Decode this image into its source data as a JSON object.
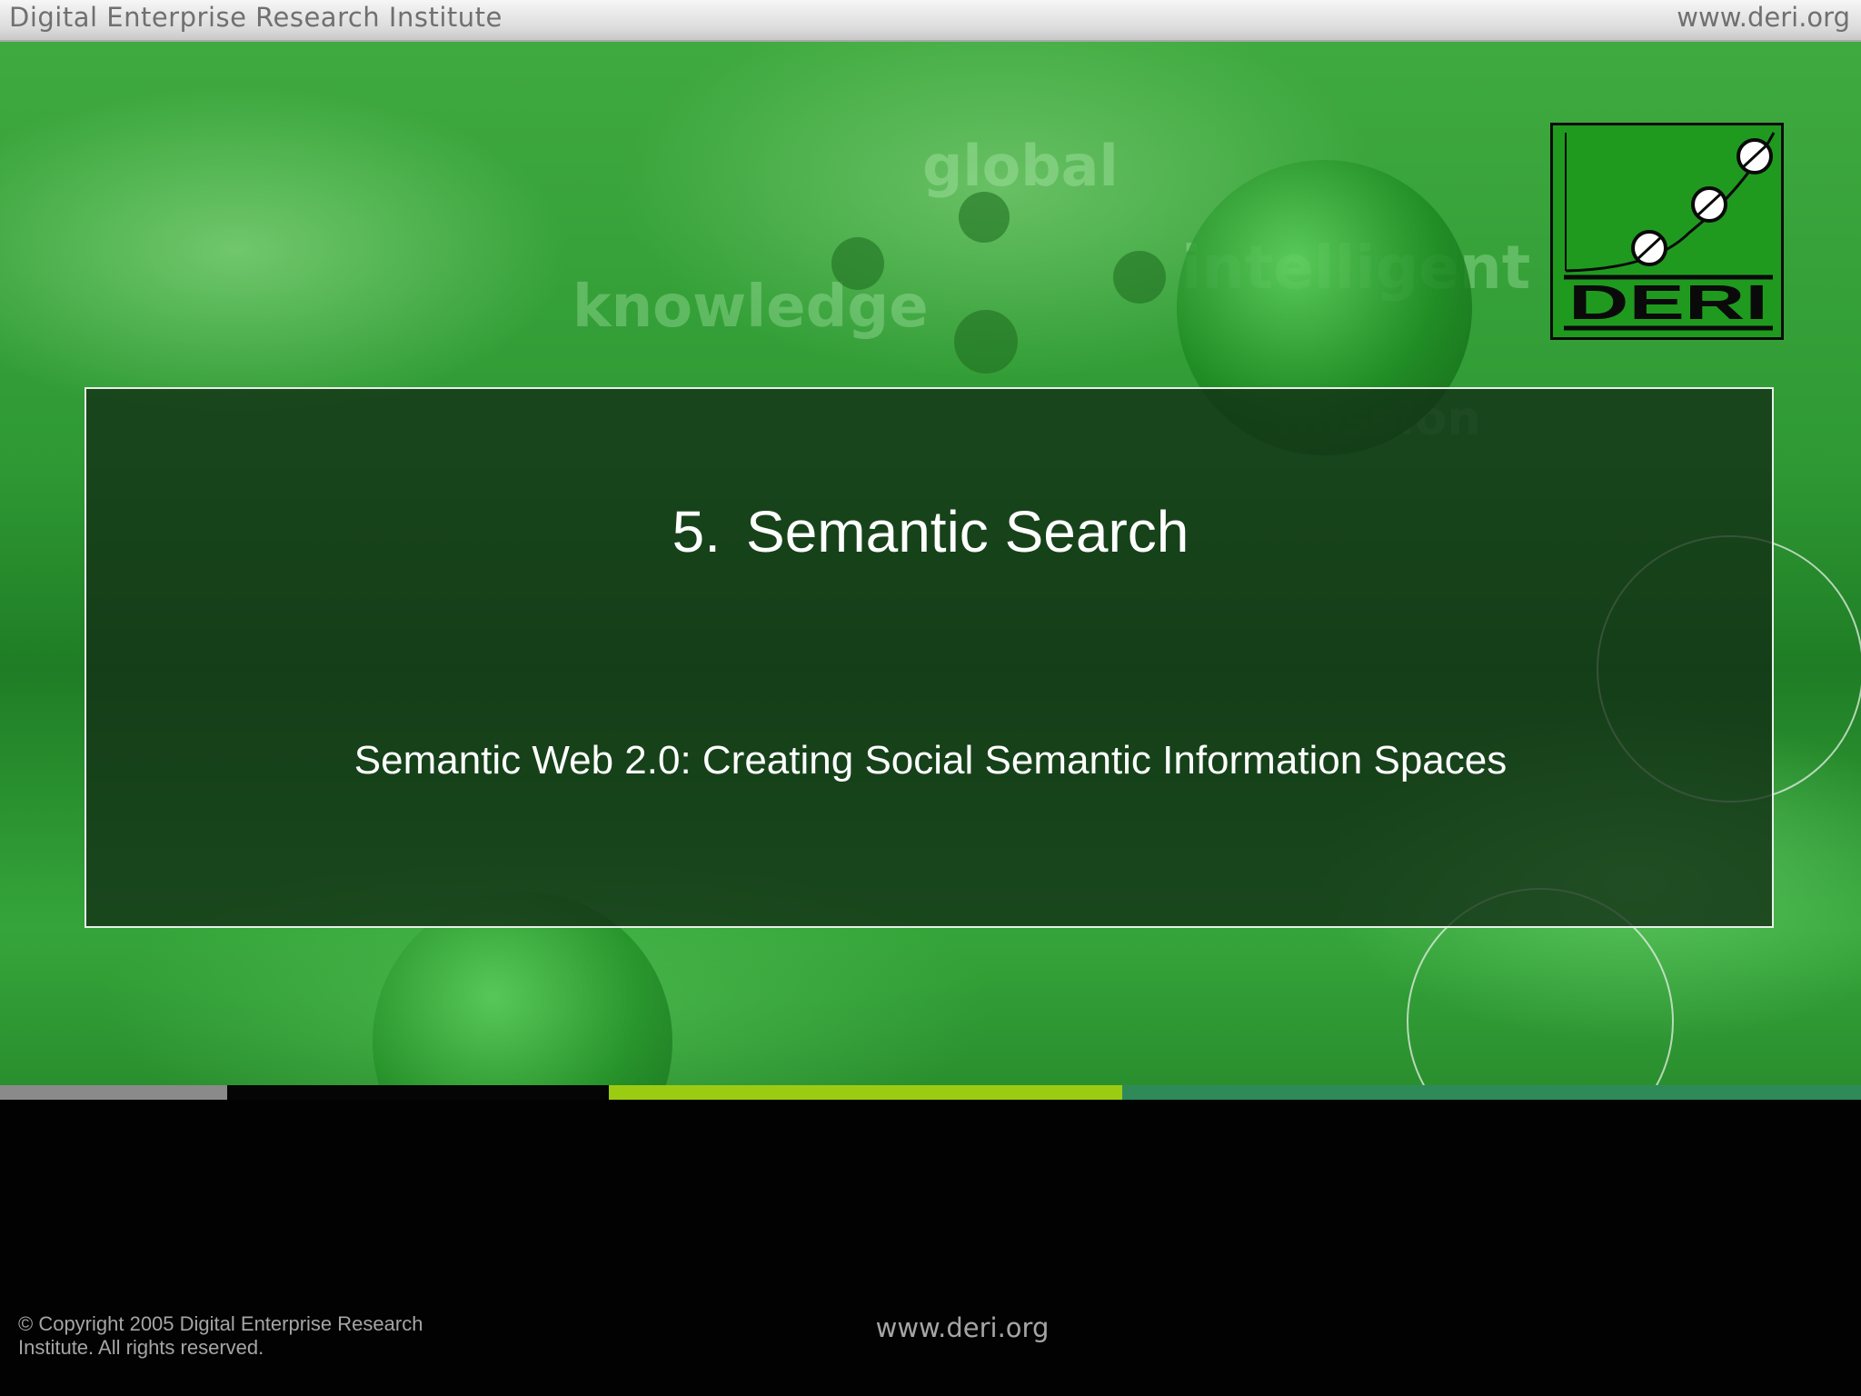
{
  "header": {
    "institute": "Digital Enterprise Research Institute",
    "url": "www.deri.org"
  },
  "background_words": {
    "global": "global",
    "knowledge": "knowledge",
    "intelligent": "intelligent",
    "mission": "mission"
  },
  "slide": {
    "number": "5.",
    "title": "Semantic Search",
    "subtitle": "Semantic Web 2.0: Creating Social Semantic Information Spaces"
  },
  "logo": {
    "text": "DERI",
    "icon": "deri-logo"
  },
  "stripe_colors": [
    "#8a8a8a",
    "#050505",
    "#9ccc12",
    "#2f8a5a"
  ],
  "footer": {
    "copyright_line1": "© Copyright 2005 Digital Enterprise Research",
    "copyright_line2": "Institute. All rights reserved.",
    "url": "www.deri.org"
  }
}
